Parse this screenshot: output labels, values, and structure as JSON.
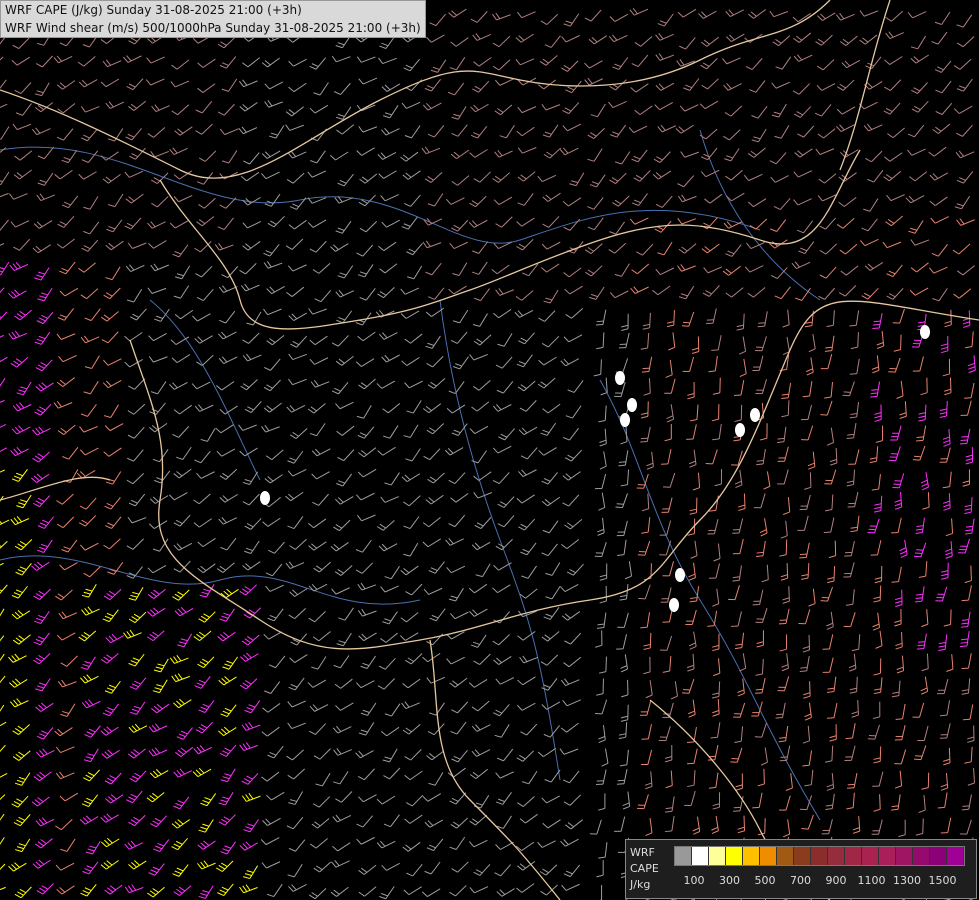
{
  "title": {
    "line1": "WRF CAPE (J/kg) Sunday 31-08-2025 21:00 (+3h)",
    "line2": "WRF Wind shear (m/s) 500/1000hPa Sunday 31-08-2025 21:00 (+3h)"
  },
  "legend": {
    "label_model": "WRF",
    "label_var": "CAPE",
    "label_unit": "J/kg",
    "colors": [
      "#999999",
      "#ffffff",
      "#ffff9a",
      "#ffff00",
      "#ffc000",
      "#f08c00",
      "#a05a14",
      "#8c3c1e",
      "#8c2d2d",
      "#962d3c",
      "#a02846",
      "#aa2350",
      "#aa1e5a",
      "#a01464",
      "#960a6e",
      "#8c0078",
      "#a00096"
    ],
    "tick_labels": [
      "100",
      "300",
      "500",
      "700",
      "900",
      "1100",
      "1300",
      "1500"
    ]
  },
  "map": {
    "background": "#000000",
    "barb_colors": {
      "low": "#9e9e9e",
      "mid": "#b08080",
      "high": "#e8826e",
      "strong": "#ff30ff",
      "extreme": "#ffff00"
    },
    "border_color": "#e6c8a0",
    "river_color": "#4a6fb0"
  }
}
